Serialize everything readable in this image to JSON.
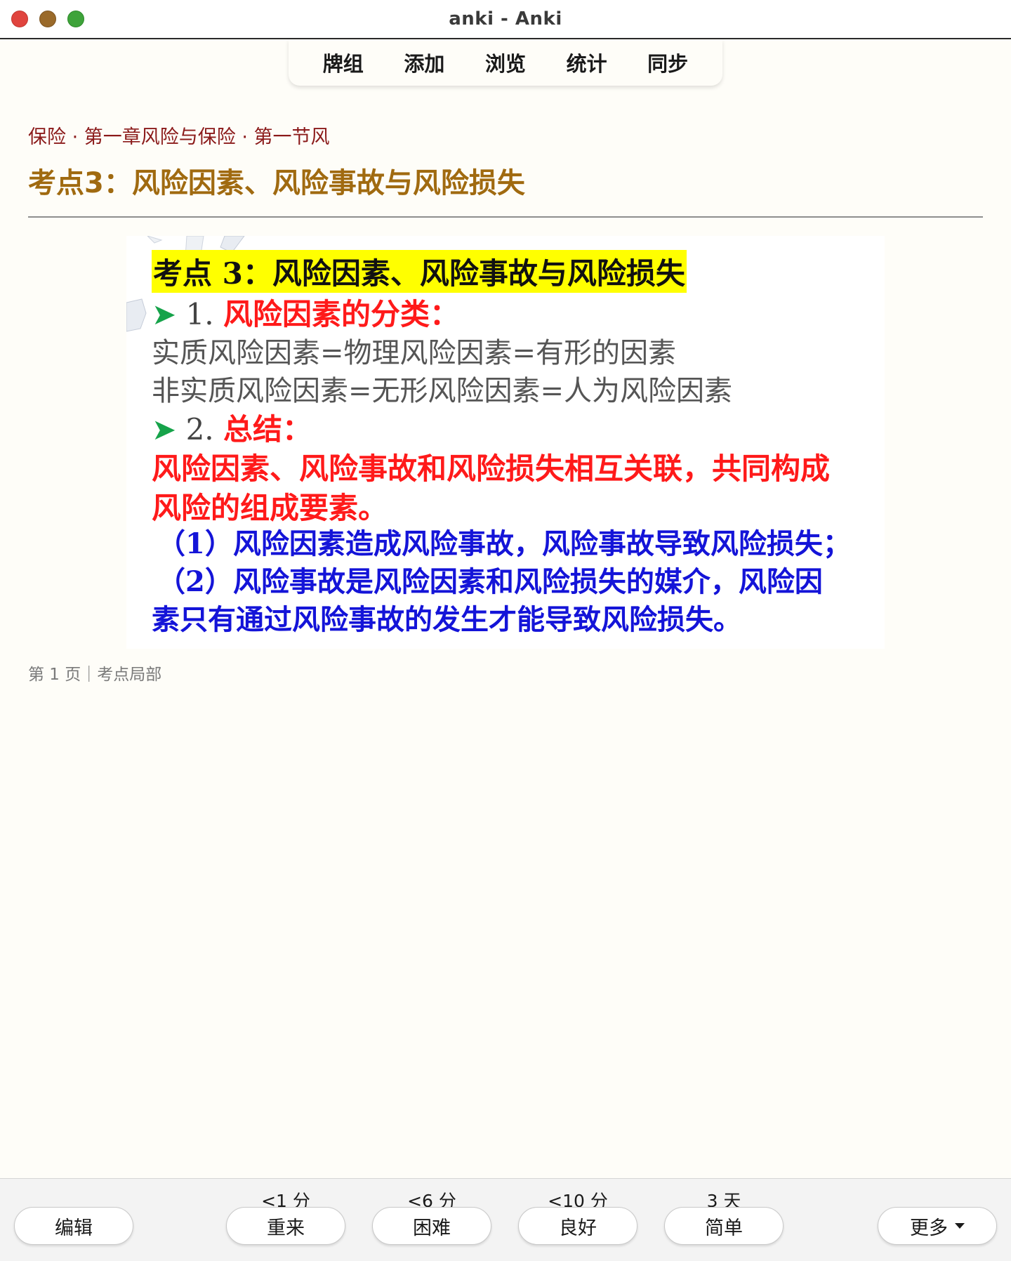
{
  "window": {
    "title": "anki - Anki"
  },
  "topnav": {
    "items": [
      "牌组",
      "添加",
      "浏览",
      "统计",
      "同步"
    ]
  },
  "card": {
    "breadcrumb": "保险 · 第一章风险与保险 · 第一节风",
    "title": "考点3：风险因素、风险事故与风险损失",
    "slide": {
      "heading": "考点 3：风险因素、风险事故与风险损失",
      "arrow_glyph": "➤",
      "item1_num": "1.",
      "item1_label": "风险因素的分类：",
      "line_tangible": "实质风险因素=物理风险因素=有形的因素",
      "line_intangible": "非实质风险因素=无形风险因素=人为风险因素",
      "item2_num": "2.",
      "item2_label": "总结：",
      "summary_line1": "风险因素、风险事故和风险损失相互关联，共同构成",
      "summary_line2": "风险的组成要素。",
      "point1": "（1）风险因素造成风险事故，风险事故导致风险损失；",
      "point2_line1": "（2）风险事故是风险因素和风险损失的媒介，风险因",
      "point2_line2": "素只有通过风险事故的发生才能导致风险损失。"
    },
    "footer_note": "第 1 页｜考点局部"
  },
  "answer_bar": {
    "edit_label": "编辑",
    "more_label": "更多",
    "buttons": [
      {
        "label": "重来",
        "due": "<1 分"
      },
      {
        "label": "困难",
        "due": "<6 分"
      },
      {
        "label": "良好",
        "due": "<10 分"
      },
      {
        "label": "简单",
        "due": "3 天"
      }
    ]
  },
  "colors": {
    "background": "#fefdf8",
    "breadcrumb": "#8b1a1a",
    "title": "#a06a10",
    "slide_highlight": "#ffff00",
    "slide_red": "#ff1a1a",
    "slide_blue": "#1414d8",
    "slide_arrow": "#16a34a"
  }
}
